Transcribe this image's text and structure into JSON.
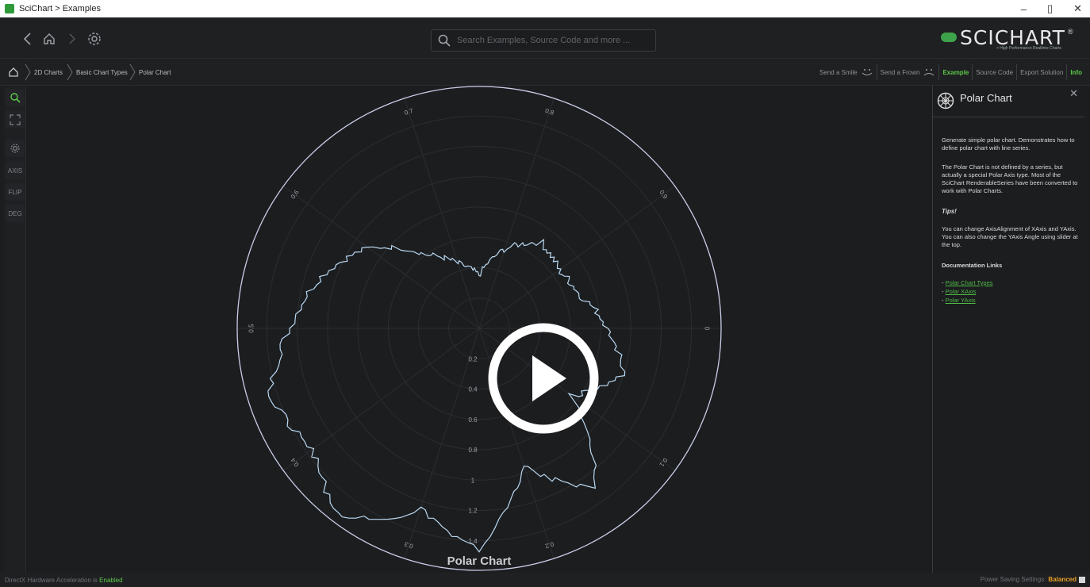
{
  "window": {
    "title": "SciChart > Examples",
    "minimize": "–",
    "maximize": "▯",
    "close": "✕"
  },
  "search": {
    "placeholder": "Search Examples, Source Code and more ..."
  },
  "logo": {
    "word": "SCICHART",
    "reg": "®",
    "tagline": "> High Performance Realtime Charts"
  },
  "breadcrumb": [
    "2D Charts",
    "Basic Chart Types",
    "Polar Chart"
  ],
  "header_links": {
    "smile": "Send a Smile",
    "frown": "Send a Frown",
    "example": "Example",
    "source": "Source Code",
    "export": "Export Solution",
    "info": "Info"
  },
  "left_tools": {
    "axis": "AXIS",
    "flip": "FLIP",
    "deg": "DEG"
  },
  "panel": {
    "title": "Polar Chart",
    "close": "✕",
    "p1": "Generate simple polar chart. Demonstrates how to define polar chart with line series.",
    "p2": "The Polar Chart is not defined by a series, but actually a special Polar Axis type. Most of the SciChart RenderableSeries have been converted to work with Polar Charts.",
    "tips_heading": "Tips!",
    "p3": "You can change AxisAlignment of XAxis and YAxis. You can also change the YAxis Angle using slider at the top.",
    "doc_heading": "Documentation Links",
    "links": [
      "Polar Chart Types",
      "Polar XAxis",
      "Polar YAxis"
    ]
  },
  "status": {
    "left_prefix": "DirectX Hardware Acceleration is",
    "left_value": "Enabled",
    "right_prefix": "Power Saving Settings:",
    "right_value": "Balanced"
  },
  "colors": {
    "accent_green": "#5cc84a",
    "series": "#b9d9f2",
    "axis_circle": "#c8cde6",
    "warning": "#e8a224"
  },
  "chart_data": {
    "type": "line",
    "title": "Polar Chart",
    "angular_axis": {
      "ticks": [
        "0",
        "0.1",
        "0.2",
        "0.3",
        "0.4",
        "0.5",
        "0.6",
        "0.7",
        "0.8",
        "0.9"
      ],
      "range": [
        0,
        1
      ]
    },
    "radial_axis": {
      "ticks": [
        "0.2",
        "0.4",
        "0.6",
        "0.8",
        "1",
        "1.2",
        "1.4"
      ],
      "range": [
        0,
        1.6
      ]
    },
    "series": [
      {
        "x": [
          0.0,
          0.05,
          0.1,
          0.15,
          0.2,
          0.25,
          0.3,
          0.35,
          0.4,
          0.45,
          0.5,
          0.55,
          0.6,
          0.65,
          0.7,
          0.75,
          0.8,
          0.85,
          0.9,
          0.95
        ],
        "y": [
          0.85,
          1.0,
          0.75,
          1.3,
          0.95,
          1.45,
          1.25,
          1.55,
          1.35,
          1.45,
          1.25,
          1.1,
          0.9,
          0.6,
          0.45,
          0.35,
          0.55,
          0.7,
          0.65,
          0.7
        ]
      }
    ],
    "grid": true
  }
}
